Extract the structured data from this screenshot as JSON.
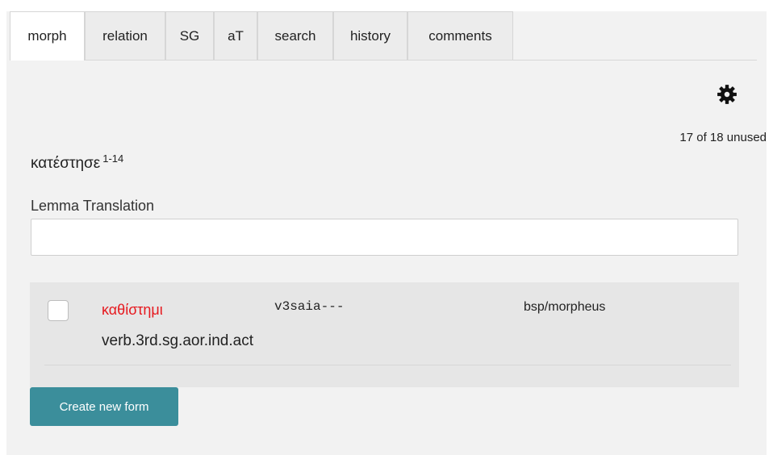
{
  "tabs": [
    {
      "label": "morph",
      "active": true
    },
    {
      "label": "relation",
      "active": false
    },
    {
      "label": "SG",
      "active": false
    },
    {
      "label": "aT",
      "active": false
    },
    {
      "label": "search",
      "active": false
    },
    {
      "label": "history",
      "active": false
    },
    {
      "label": "comments",
      "active": false
    }
  ],
  "settings": {
    "icon": "gear-icon"
  },
  "status": {
    "unused_text": "17 of 18 unused"
  },
  "word": {
    "form": "κατέστησε",
    "ref": "1-14"
  },
  "translation": {
    "label": "Lemma Translation",
    "value": "",
    "placeholder": ""
  },
  "analysis": {
    "lemma": "καθίστημι",
    "code": "v3saia---",
    "source": "bsp/morpheus",
    "postag": "verb.3rd.sg.aor.ind.act",
    "checked": false,
    "lemma_color": "#e6191f"
  },
  "actions": {
    "create_label": "Create new form",
    "button_color": "#3b8e9b"
  }
}
